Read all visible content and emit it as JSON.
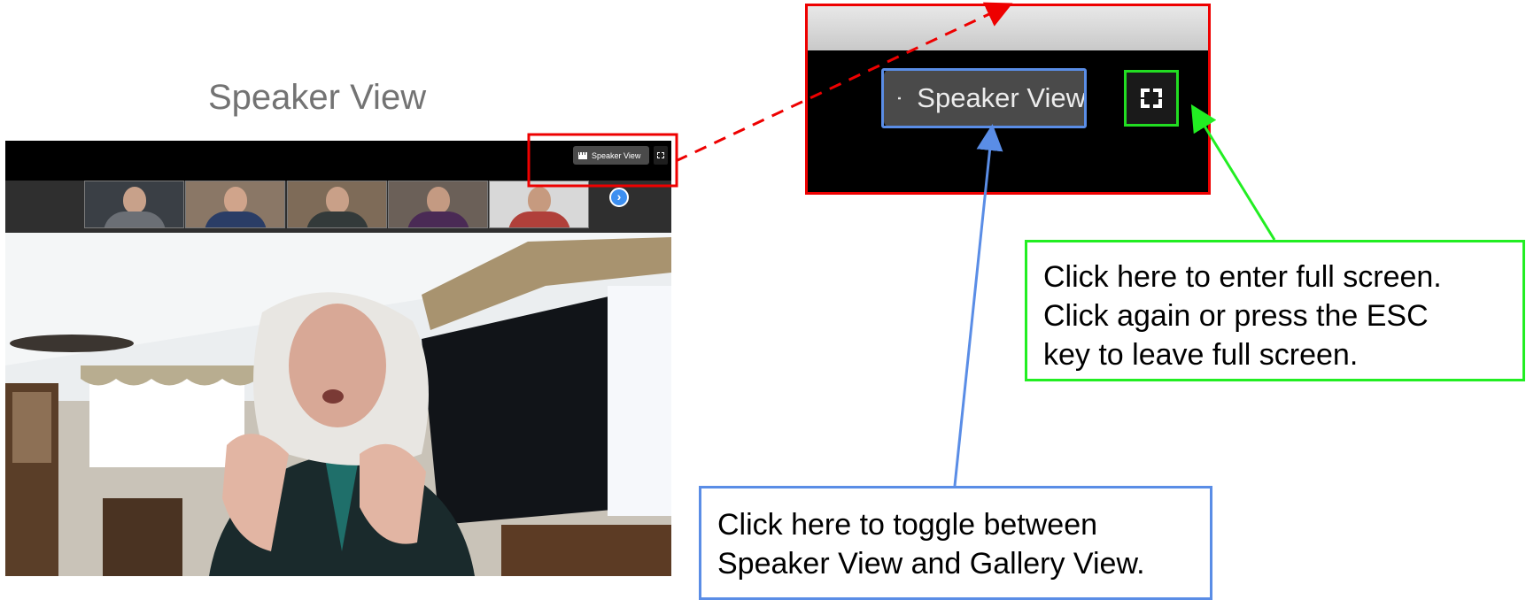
{
  "title": "Speaker View",
  "zoom_window": {
    "view_button_label": "Speaker View",
    "participants": [
      {
        "bg": "#3a3f45",
        "shirt": "#6b6f75"
      },
      {
        "bg": "#8a7766",
        "shirt": "#2a3d66"
      },
      {
        "bg": "#7e6b58",
        "shirt": "#333a3a"
      },
      {
        "bg": "#6b6058",
        "shirt": "#4a2a55"
      },
      {
        "bg": "#d8d8d8",
        "shirt": "#b0403a"
      }
    ]
  },
  "zoom_inset": {
    "view_button_label": "Speaker View"
  },
  "callouts": {
    "full_screen": [
      "Click here to enter full screen.",
      "Click again or press the ESC",
      "key to leave full screen."
    ],
    "toggle_view": [
      "Click here to toggle between",
      "Speaker View and Gallery View."
    ]
  },
  "colors": {
    "highlight_red": "#ee0000",
    "highlight_green": "#22ee22",
    "highlight_blue": "#5a8de6"
  }
}
